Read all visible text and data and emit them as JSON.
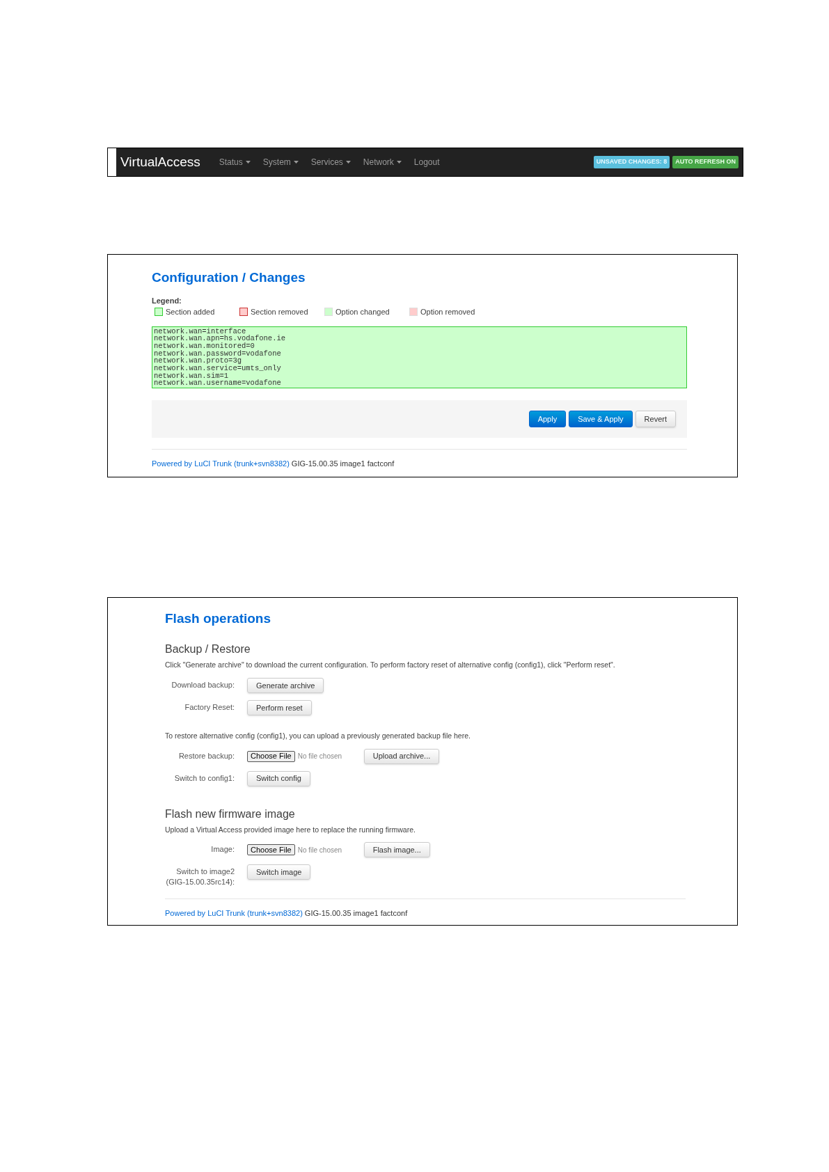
{
  "navbar": {
    "brand": "VirtualAccess",
    "menus": [
      {
        "label": "Status",
        "dropdown": true
      },
      {
        "label": "System",
        "dropdown": true
      },
      {
        "label": "Services",
        "dropdown": true
      },
      {
        "label": "Network",
        "dropdown": true
      },
      {
        "label": "Logout",
        "dropdown": false
      }
    ],
    "badges": [
      {
        "label": "UNSAVED CHANGES: 8",
        "kind": "info"
      },
      {
        "label": "AUTO REFRESH ON",
        "kind": "success"
      }
    ]
  },
  "changes_page": {
    "title": "Configuration / Changes",
    "legend_label": "Legend:",
    "legend": [
      {
        "label": "Section added",
        "kind": "strong",
        "color": "#ccffcc"
      },
      {
        "label": "Section removed",
        "kind": "strong",
        "color": "#ffcccc"
      },
      {
        "label": "Option changed",
        "kind": "light",
        "color": "#ccffcc"
      },
      {
        "label": "Option removed",
        "kind": "light",
        "color": "#ffcccc"
      }
    ],
    "changes": [
      "network.wan=interface",
      "network.wan.apn=hs.vodafone.ie",
      "network.wan.monitored=0",
      "network.wan.password=vodafone",
      "network.wan.proto=3g",
      "network.wan.service=umts_only",
      "network.wan.sim=1",
      "network.wan.username=vodafone"
    ],
    "buttons": [
      {
        "label": "Apply",
        "kind": "primary"
      },
      {
        "label": "Save & Apply",
        "kind": "primary"
      },
      {
        "label": "Revert",
        "kind": "default"
      }
    ],
    "footer": {
      "link": "Powered by LuCI Trunk (trunk+svn8382)",
      "text": "GIG-15.00.35 image1 factconf"
    }
  },
  "flash_page": {
    "title": "Flash operations",
    "sections": [
      {
        "heading": "Backup / Restore",
        "blocks": [
          {
            "description": "Click \"Generate archive\" to download the current configuration. To perform factory reset of alternative config (config1), click \"Perform reset\".",
            "rows": [
              {
                "kind": "button",
                "label": [
                  "Download backup:"
                ],
                "button": "Generate archive"
              },
              {
                "kind": "button",
                "label": [
                  "Factory Reset:"
                ],
                "button": "Perform reset"
              }
            ]
          },
          {
            "description": "To restore alternative config (config1), you can upload a previously generated backup file here.",
            "rows": [
              {
                "kind": "file",
                "label": [
                  "Restore backup:"
                ],
                "file_button": "Choose File",
                "file_status": "No file chosen",
                "button": "Upload archive..."
              },
              {
                "kind": "button",
                "label": [
                  "Switch to config1:"
                ],
                "button": "Switch config"
              }
            ]
          }
        ]
      },
      {
        "heading": "Flash new firmware image",
        "blocks": [
          {
            "description": "Upload a Virtual Access provided image here to replace the running firmware.",
            "rows": [
              {
                "kind": "file",
                "label": [
                  "Image:"
                ],
                "file_button": "Choose File",
                "file_status": "No file chosen",
                "button": "Flash image..."
              },
              {
                "kind": "button",
                "label": [
                  "Switch to image2",
                  "(GIG-15.00.35rc14):"
                ],
                "button": "Switch image"
              }
            ]
          }
        ]
      }
    ],
    "footer": {
      "link": "Powered by LuCI Trunk (trunk+svn8382)",
      "text": "GIG-15.00.35 image1 factconf"
    }
  }
}
